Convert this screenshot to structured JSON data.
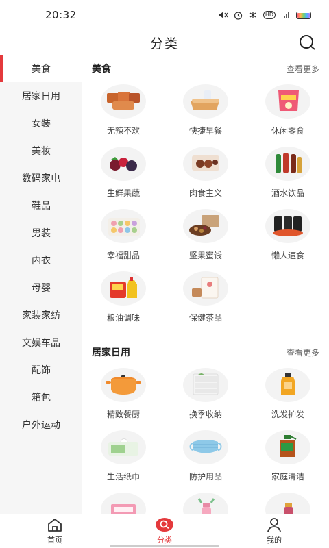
{
  "status_bar": {
    "time": "20:32",
    "hd": "HD"
  },
  "header": {
    "title": "分类"
  },
  "sidebar": {
    "items": [
      {
        "label": "美食"
      },
      {
        "label": "居家日用"
      },
      {
        "label": "女装"
      },
      {
        "label": "美妆"
      },
      {
        "label": "数码家电"
      },
      {
        "label": "鞋品"
      },
      {
        "label": "男装"
      },
      {
        "label": "内衣"
      },
      {
        "label": "母婴"
      },
      {
        "label": "家装家纺"
      },
      {
        "label": "文娱车品"
      },
      {
        "label": "配饰"
      },
      {
        "label": "箱包"
      },
      {
        "label": "户外运动"
      }
    ],
    "active_index": 0
  },
  "sections": [
    {
      "title": "美食",
      "more": "查看更多",
      "items": [
        {
          "label": "无辣不欢",
          "icon": "spicy-snack-icon"
        },
        {
          "label": "快捷早餐",
          "icon": "bread-milk-icon"
        },
        {
          "label": "休闲零食",
          "icon": "snack-bag-icon"
        },
        {
          "label": "生鲜果蔬",
          "icon": "fruit-icon"
        },
        {
          "label": "肉食主义",
          "icon": "meat-box-icon"
        },
        {
          "label": "酒水饮品",
          "icon": "drink-bottles-icon"
        },
        {
          "label": "幸福甜品",
          "icon": "macaron-icon"
        },
        {
          "label": "坚果蜜饯",
          "icon": "nuts-icon"
        },
        {
          "label": "懒人速食",
          "icon": "instant-noodle-icon"
        },
        {
          "label": "粮油调味",
          "icon": "rice-oil-icon"
        },
        {
          "label": "保健茶品",
          "icon": "tea-box-icon"
        }
      ]
    },
    {
      "title": "居家日用",
      "more": "查看更多",
      "items": [
        {
          "label": "精致餐厨",
          "icon": "cooking-pot-icon"
        },
        {
          "label": "换季收纳",
          "icon": "storage-drawer-icon"
        },
        {
          "label": "洗发护发",
          "icon": "shampoo-bottle-icon"
        },
        {
          "label": "生活纸巾",
          "icon": "tissue-box-icon"
        },
        {
          "label": "防护用品",
          "icon": "face-mask-icon"
        },
        {
          "label": "家庭清洁",
          "icon": "cleaner-bottle-icon"
        },
        {
          "label": "",
          "icon": "pink-box-icon"
        },
        {
          "label": "",
          "icon": "water-bottle-icon"
        },
        {
          "label": "",
          "icon": "cosmetic-jar-icon"
        }
      ]
    }
  ],
  "bottom_nav": [
    {
      "label": "首页",
      "icon": "home-icon"
    },
    {
      "label": "分类",
      "icon": "category-search-icon",
      "active": true
    },
    {
      "label": "我的",
      "icon": "user-icon"
    }
  ],
  "colors": {
    "accent": "#e4393c",
    "sidebar_bg": "#f6f6f6",
    "thumb_bg": "#f3f3f3"
  }
}
